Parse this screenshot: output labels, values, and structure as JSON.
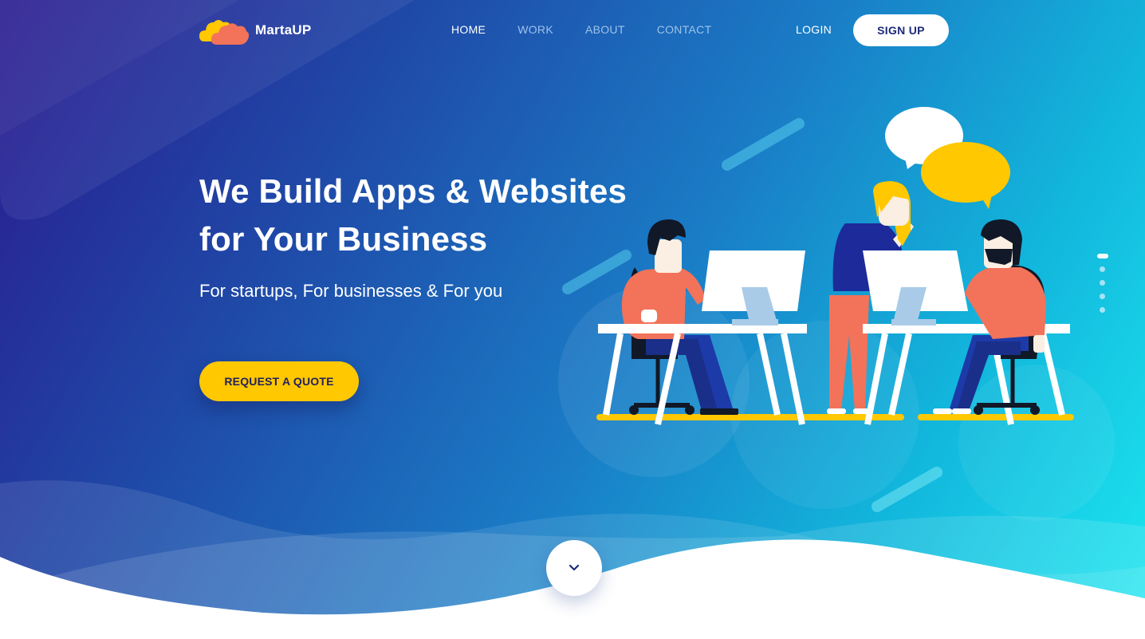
{
  "brand": {
    "name": "MartaUP",
    "logo_icon": "cloud-logo-icon"
  },
  "nav": {
    "items": [
      {
        "label": "HOME",
        "active": true
      },
      {
        "label": "WORK",
        "active": false
      },
      {
        "label": "ABOUT",
        "active": false
      },
      {
        "label": "CONTACT",
        "active": false
      }
    ],
    "login_label": "LOGIN",
    "signup_label": "SIGN UP"
  },
  "hero": {
    "headline_line1": "We Build Apps & Websites",
    "headline_line2": "for Your Business",
    "subline": "For startups, For businesses & For you",
    "cta_label": "REQUEST A QUOTE"
  },
  "slider": {
    "dot_count": 5,
    "active_index": 0
  },
  "scroll_down": {
    "icon": "chevron-down-icon"
  },
  "colors": {
    "accent_yellow": "#ffc800",
    "coral": "#f2735a",
    "navy": "#1d2a7a",
    "gradient_start": "#2a1a8f",
    "gradient_end": "#1de8f0"
  }
}
